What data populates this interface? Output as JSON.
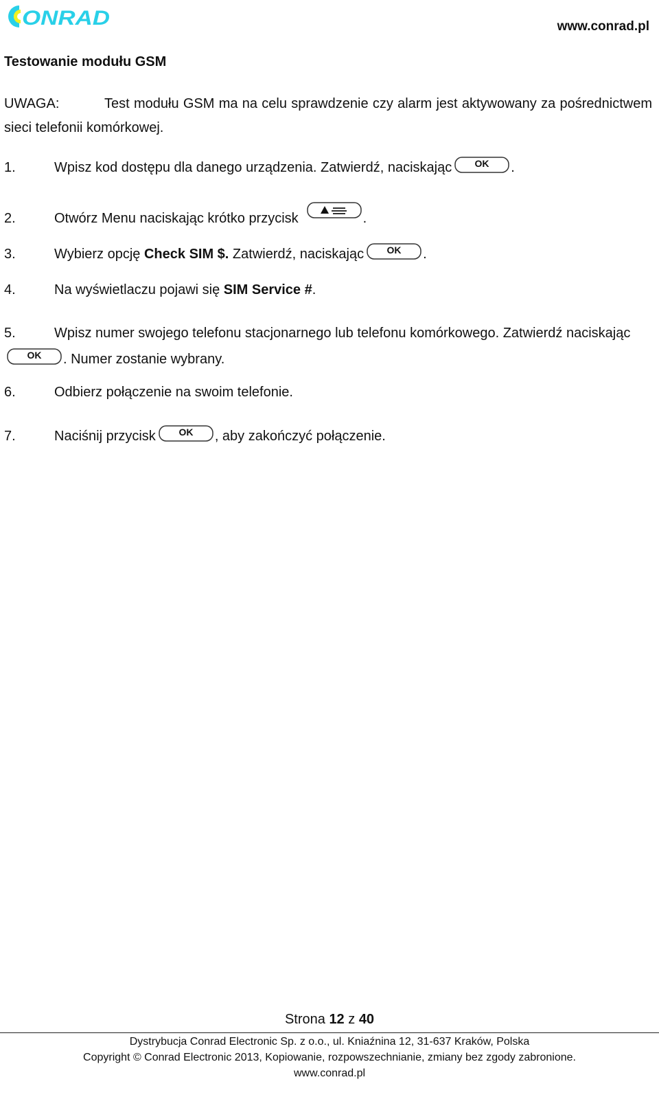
{
  "header": {
    "logo_text": "CONRAD",
    "logo_colors": {
      "primary": "#29D0E8",
      "accent": "#F2F21E"
    },
    "website": "www.conrad.pl"
  },
  "section": {
    "title": "Testowanie modułu GSM",
    "note_label": "UWAGA:",
    "note_text": "Test modułu GSM ma na celu sprawdzenie czy alarm jest aktywowany za pośrednictwem sieci telefonii komórkowej."
  },
  "buttons": {
    "ok_label": "OK",
    "menu_icon": "triangle-up-and-menu-lines-icon"
  },
  "steps": [
    {
      "num": "1.",
      "before": "Wpisz kod dostępu dla danego urządzenia. Zatwierdź, naciskając",
      "button": "ok",
      "after": "."
    },
    {
      "num": "2.",
      "before": "Otwórz Menu naciskając krótko przycisk",
      "button": "menu",
      "after": "."
    },
    {
      "num": "3.",
      "before": "Wybierz opcję ",
      "bold": "Check SIM $.",
      "middle": " Zatwierdź, naciskając",
      "button": "ok",
      "after": "."
    },
    {
      "num": "4.",
      "before": "Na wyświetlaczu pojawi się ",
      "bold": "SIM Service #",
      "after": "."
    },
    {
      "num": "5.",
      "before": "Wpisz numer swojego telefonu stacjonarnego lub telefonu komórkowego. Zatwierdź naciskając",
      "button": "ok",
      "after": ". Numer zostanie wybrany."
    },
    {
      "num": "6.",
      "before": "Odbierz połączenie na swoim telefonie."
    },
    {
      "num": "7.",
      "before": "Naciśnij przycisk",
      "button": "ok",
      "after": ", aby zakończyć połączenie."
    }
  ],
  "footer": {
    "page_prefix": "Strona",
    "page_current": "12",
    "page_sep": "z",
    "page_total": "40",
    "distribution": "Dystrybucja Conrad Electronic Sp. z o.o., ul. Kniaźnina 12, 31-637 Kraków, Polska",
    "copyright": "Copyright © Conrad Electronic 2013, Kopiowanie, rozpowszechnianie, zmiany bez zgody zabronione.",
    "website": "www.conrad.pl"
  }
}
